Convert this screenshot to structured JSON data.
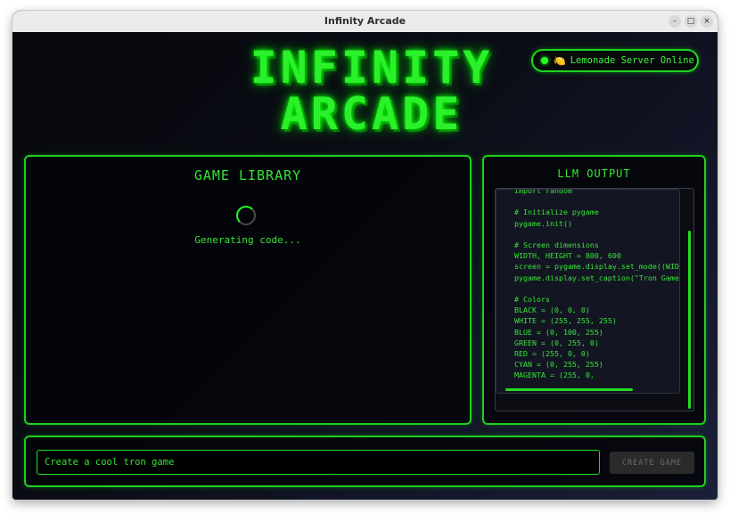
{
  "window": {
    "title": "Infinity Arcade",
    "controls": {
      "minimize": "–",
      "maximize": "□",
      "close": "×"
    }
  },
  "header": {
    "logo_line1": "INFINITY",
    "logo_line2": "ARCADE"
  },
  "status": {
    "emoji": "🍋",
    "text": "Lemonade Server Online",
    "color": "#22ff22"
  },
  "library": {
    "title": "GAME LIBRARY",
    "loading_text": "Generating code..."
  },
  "llm": {
    "title": "LLM OUTPUT",
    "code": "import random\n\n# Initialize pygame\npygame.init()\n\n# Screen dimensions\nWIDTH, HEIGHT = 800, 600\nscreen = pygame.display.set_mode((WIDTH, HEIGHT))\npygame.display.set_caption(\"Tron Game\")\n\n# Colors\nBLACK = (0, 0, 0)\nWHITE = (255, 255, 255)\nBLUE = (0, 100, 255)\nGREEN = (0, 255, 0)\nRED = (255, 0, 0)\nCYAN = (0, 255, 255)\nMAGENTA = (255, 0,"
  },
  "prompt": {
    "value": "Create a cool tron game",
    "button_label": "CREATE GAME"
  },
  "theme": {
    "accent": "#22ff22",
    "background": "#0b0c13"
  }
}
